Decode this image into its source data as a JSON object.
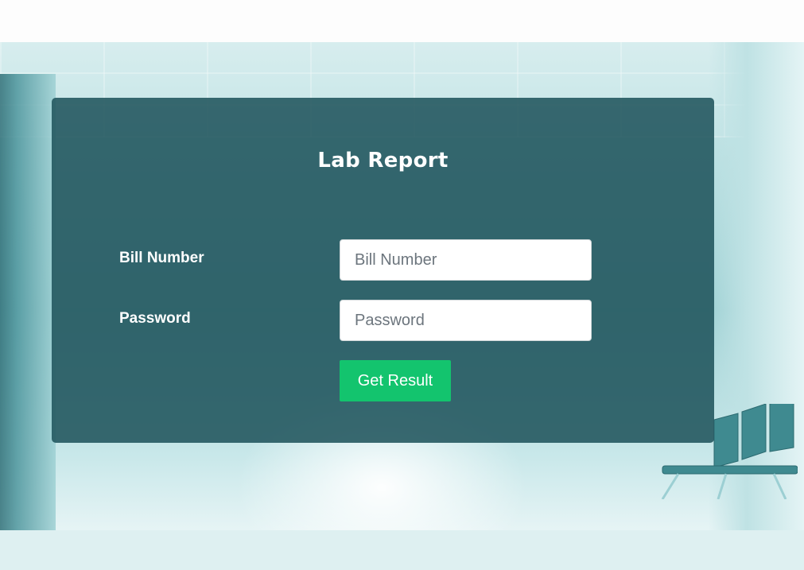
{
  "form": {
    "title": "Lab Report",
    "bill_number": {
      "label": "Bill Number",
      "placeholder": "Bill Number",
      "value": ""
    },
    "password": {
      "label": "Password",
      "placeholder": "Password",
      "value": ""
    },
    "submit_label": "Get Result"
  },
  "colors": {
    "panel_background": "#20545c",
    "submit_button": "#13c46e",
    "text": "#ffffff"
  }
}
